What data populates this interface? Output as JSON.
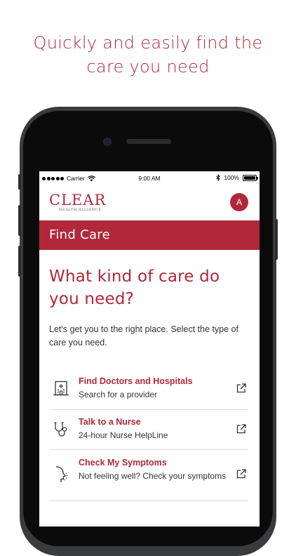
{
  "tagline": {
    "line1": "Quickly and easily find the",
    "line2": "care you need"
  },
  "statusbar": {
    "carrier": "Carrier",
    "time": "9:00 AM",
    "battery": "100%"
  },
  "header": {
    "logo_text": "CLEAR",
    "logo_subtext": "HEALTH ALLIANCE",
    "avatar_initial": "A"
  },
  "banner": {
    "title": "Find Care"
  },
  "main": {
    "question": "What kind of care do you need?",
    "intro": "Let's get you to the right place. Select the type of care you need."
  },
  "care_options": [
    {
      "title": "Find Doctors and Hospitals",
      "subtitle": "Search for a provider",
      "icon": "hospital-icon"
    },
    {
      "title": "Talk to a Nurse",
      "subtitle": "24-hour Nurse HelpLine",
      "icon": "stethoscope-icon"
    },
    {
      "title": "Check My Symptoms",
      "subtitle": "Not feeling well? Check your symptoms",
      "icon": "symptoms-head-icon"
    }
  ],
  "colors": {
    "brand": "#b0283a",
    "divider": "#dcdcdc",
    "text": "#333333"
  }
}
